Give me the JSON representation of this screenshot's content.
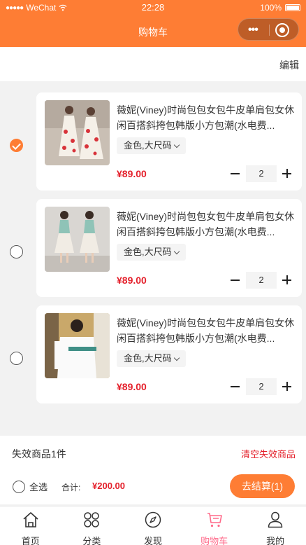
{
  "status_bar": {
    "carrier": "WeChat",
    "signal": "●●●●●",
    "time": "22:28",
    "battery": "100%"
  },
  "nav": {
    "title": "购物车"
  },
  "edit_label": "编辑",
  "items": [
    {
      "checked": true,
      "title": "薇妮(Viney)时尚包包女包牛皮单肩包女休闲百搭斜挎包韩版小方包潮(水电费...",
      "spec": "金色,大尺码",
      "price": "¥89.00",
      "qty": "2",
      "image": "dress-photo"
    },
    {
      "checked": false,
      "title": "薇妮(Viney)时尚包包女包牛皮单肩包女休闲百搭斜挎包韩版小方包潮(水电费...",
      "spec": "金色,大尺码",
      "price": "¥89.00",
      "qty": "2",
      "image": "skirt-photo"
    },
    {
      "checked": false,
      "title": "薇妮(Viney)时尚包包女包牛皮单肩包女休闲百搭斜挎包韩版小方包潮(水电费...",
      "spec": "金色,大尺码",
      "price": "¥89.00",
      "qty": "2",
      "image": "sweater-photo"
    }
  ],
  "invalid": {
    "label": "失效商品1件",
    "clear": "清空失效商品"
  },
  "checkout": {
    "select_all": "全选",
    "total_label": "合计:",
    "total": "¥200.00",
    "button": "去结算(1)"
  },
  "tabs": [
    {
      "label": "首页",
      "icon": "home-icon"
    },
    {
      "label": "分类",
      "icon": "category-icon"
    },
    {
      "label": "发现",
      "icon": "compass-icon"
    },
    {
      "label": "购物车",
      "icon": "cart-icon",
      "active": true
    },
    {
      "label": "我的",
      "icon": "user-icon"
    }
  ],
  "colors": {
    "accent": "#fe7d34",
    "price": "#e4202b",
    "active_tab": "#ff6a8a"
  }
}
